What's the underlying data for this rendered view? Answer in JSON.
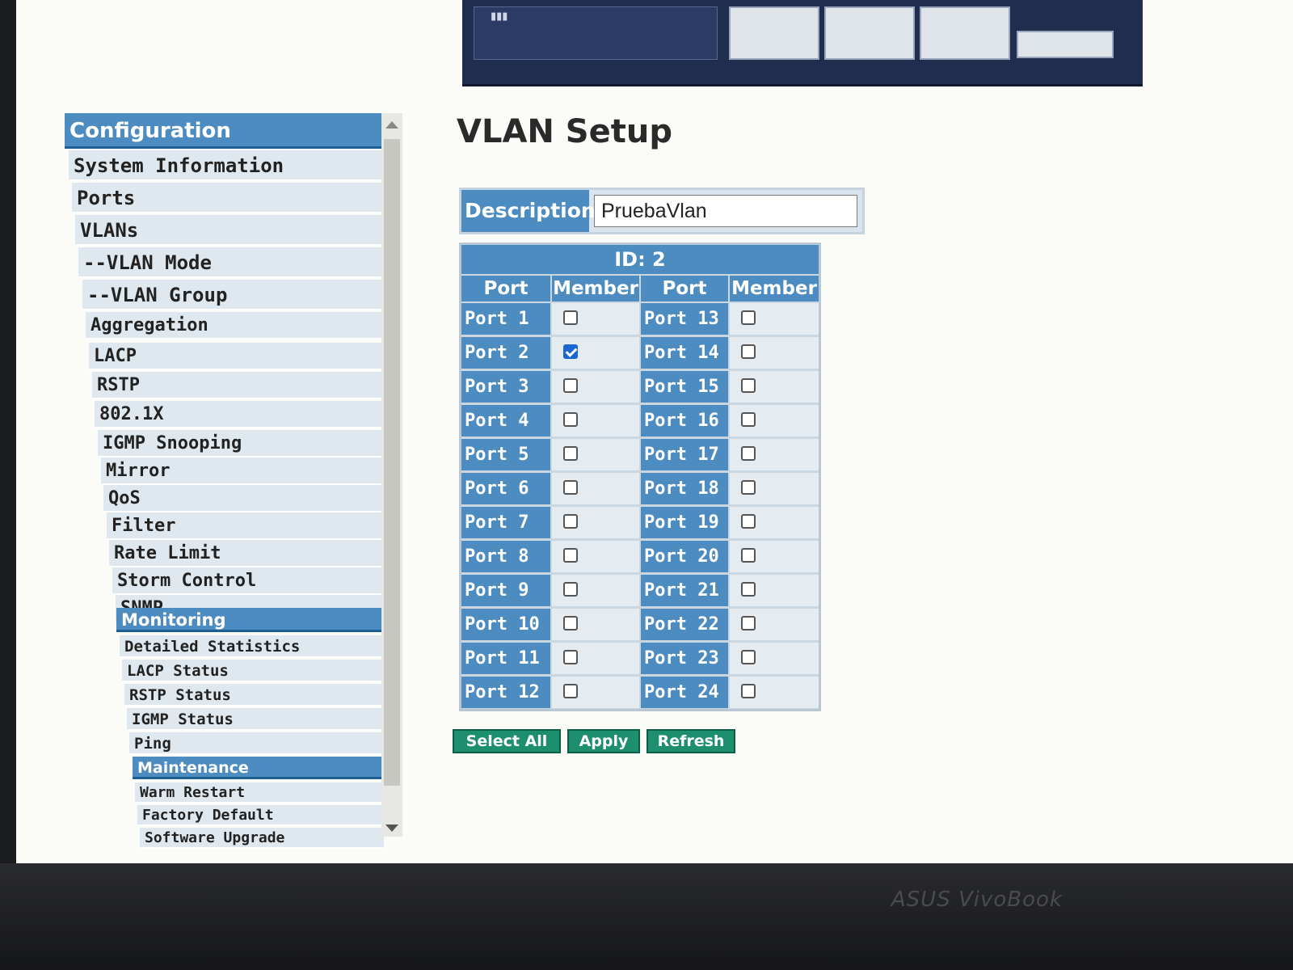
{
  "brand": {
    "laptop": "ASUS VivoBook"
  },
  "sidebar": {
    "header_config": "Configuration",
    "config_items": [
      "System Information",
      "Ports",
      "VLANs",
      "--VLAN Mode",
      "--VLAN Group",
      "Aggregation",
      "LACP",
      "RSTP",
      "802.1X",
      "IGMP Snooping",
      "Mirror",
      "QoS",
      "Filter",
      "Rate Limit",
      "Storm Control",
      "SNMP"
    ],
    "header_monitoring": "Monitoring",
    "monitoring_items": [
      "Detailed Statistics",
      "LACP Status",
      "RSTP Status",
      "IGMP Status",
      "Ping"
    ],
    "header_maintenance": "Maintenance",
    "maintenance_items": [
      "Warm Restart",
      "Factory Default",
      "Software Upgrade"
    ]
  },
  "main": {
    "title": "VLAN Setup",
    "description_label": "Description",
    "description_value": "PruebaVlan",
    "vlan_id_label": "ID: 2",
    "col_port": "Port",
    "col_member": "Member",
    "ports_left": [
      {
        "label": "Port 1",
        "checked": false
      },
      {
        "label": "Port 2",
        "checked": true
      },
      {
        "label": "Port 3",
        "checked": false
      },
      {
        "label": "Port 4",
        "checked": false
      },
      {
        "label": "Port 5",
        "checked": false
      },
      {
        "label": "Port 6",
        "checked": false
      },
      {
        "label": "Port 7",
        "checked": false
      },
      {
        "label": "Port 8",
        "checked": false
      },
      {
        "label": "Port 9",
        "checked": false
      },
      {
        "label": "Port 10",
        "checked": false
      },
      {
        "label": "Port 11",
        "checked": false
      },
      {
        "label": "Port 12",
        "checked": false
      }
    ],
    "ports_right": [
      {
        "label": "Port 13",
        "checked": false
      },
      {
        "label": "Port 14",
        "checked": false
      },
      {
        "label": "Port 15",
        "checked": false
      },
      {
        "label": "Port 16",
        "checked": false
      },
      {
        "label": "Port 17",
        "checked": false
      },
      {
        "label": "Port 18",
        "checked": false
      },
      {
        "label": "Port 19",
        "checked": false
      },
      {
        "label": "Port 20",
        "checked": false
      },
      {
        "label": "Port 21",
        "checked": false
      },
      {
        "label": "Port 22",
        "checked": false
      },
      {
        "label": "Port 23",
        "checked": false
      },
      {
        "label": "Port 24",
        "checked": false
      }
    ],
    "buttons": {
      "select_all": "Select All",
      "apply": "Apply",
      "refresh": "Refresh"
    }
  },
  "colors": {
    "header_blue": "#4d8cc0",
    "cell_light": "#e5ecf1",
    "button_green": "#1e8f6e",
    "checked_blue": "#1a67d2"
  }
}
